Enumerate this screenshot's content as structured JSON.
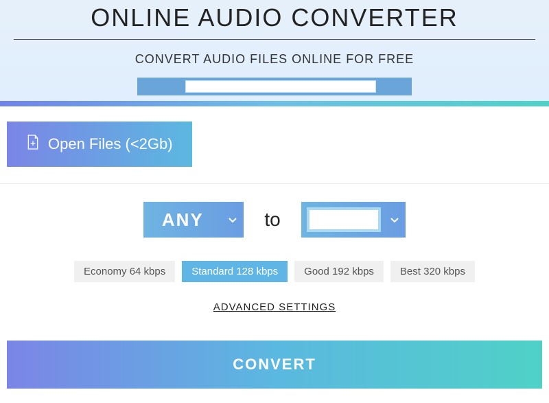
{
  "header": {
    "title": "ONLINE AUDIO CONVERTER",
    "subtitle": "CONVERT AUDIO FILES ONLINE FOR FREE"
  },
  "openFiles": {
    "label": "Open Files (<2Gb)"
  },
  "conversion": {
    "from_label": "ANY",
    "to_text": "to",
    "to_label": ""
  },
  "quality": {
    "options": [
      {
        "label": "Economy 64 kbps",
        "active": false
      },
      {
        "label": "Standard 128 kbps",
        "active": true
      },
      {
        "label": "Good 192 kbps",
        "active": false
      },
      {
        "label": "Best 320 kbps",
        "active": false
      }
    ]
  },
  "advanced": {
    "label": "ADVANCED SETTINGS"
  },
  "convert": {
    "label": "CONVERT"
  }
}
